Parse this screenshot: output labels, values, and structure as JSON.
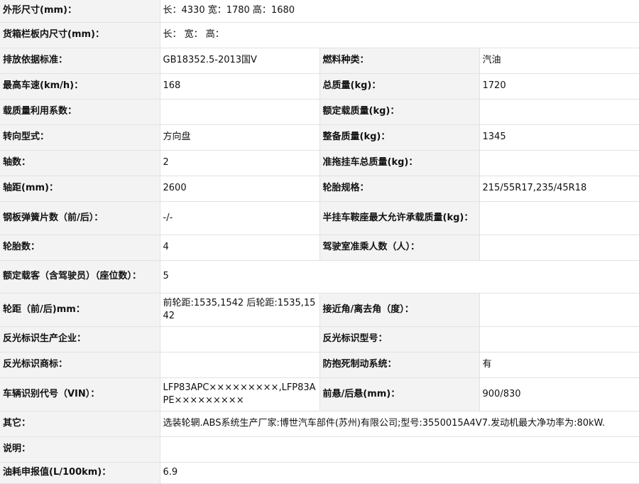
{
  "rows": [
    [
      {
        "t": "l",
        "text": "外形尺寸(mm)："
      },
      {
        "t": "v",
        "text": "长：4330 宽：1780 高：1680",
        "span": 3
      }
    ],
    [
      {
        "t": "l",
        "text": "货箱栏板内尺寸(mm)："
      },
      {
        "t": "v",
        "text": "长： 宽： 高：",
        "span": 3
      }
    ],
    [
      {
        "t": "l",
        "text": "排放依据标准："
      },
      {
        "t": "v",
        "text": "GB18352.5-2013国Ⅴ"
      },
      {
        "t": "l",
        "text": "燃料种类："
      },
      {
        "t": "v",
        "text": "汽油"
      }
    ],
    [
      {
        "t": "l",
        "text": "最高车速(km/h)："
      },
      {
        "t": "v",
        "text": "168"
      },
      {
        "t": "l",
        "text": "总质量(kg)："
      },
      {
        "t": "v",
        "text": "1720"
      }
    ],
    [
      {
        "t": "l",
        "text": "载质量利用系数："
      },
      {
        "t": "v",
        "text": ""
      },
      {
        "t": "l",
        "text": "额定载质量(kg)："
      },
      {
        "t": "v",
        "text": ""
      }
    ],
    [
      {
        "t": "l",
        "text": "转向型式："
      },
      {
        "t": "v",
        "text": "方向盘"
      },
      {
        "t": "l",
        "text": "整备质量(kg)："
      },
      {
        "t": "v",
        "text": "1345"
      }
    ],
    [
      {
        "t": "l",
        "text": "轴数："
      },
      {
        "t": "v",
        "text": "2"
      },
      {
        "t": "l",
        "text": "准拖挂车总质量(kg)："
      },
      {
        "t": "v",
        "text": ""
      }
    ],
    [
      {
        "t": "l",
        "text": "轴距(mm)："
      },
      {
        "t": "v",
        "text": "2600"
      },
      {
        "t": "l",
        "text": "轮胎规格："
      },
      {
        "t": "v",
        "text": "215/55R17,235/45R18"
      }
    ],
    [
      {
        "t": "l",
        "text": "钢板弹簧片数（前/后）："
      },
      {
        "t": "v",
        "text": "-/-"
      },
      {
        "t": "l",
        "text": "半挂车鞍座最大允许承载质量(kg)："
      },
      {
        "t": "v",
        "text": ""
      }
    ],
    [
      {
        "t": "l",
        "text": "轮胎数："
      },
      {
        "t": "v",
        "text": "4"
      },
      {
        "t": "l",
        "text": "驾驶室准乘人数（人）："
      },
      {
        "t": "v",
        "text": ""
      }
    ],
    [
      {
        "t": "l",
        "text": "额定载客（含驾驶员）（座位数）："
      },
      {
        "t": "v",
        "text": "5",
        "span": 3
      }
    ],
    [
      {
        "t": "l",
        "text": "轮距（前/后)mm："
      },
      {
        "t": "v",
        "text": "前轮距:1535,1542 后轮距:1535,1542"
      },
      {
        "t": "l",
        "text": "接近角/离去角（度）："
      },
      {
        "t": "v",
        "text": ""
      }
    ],
    [
      {
        "t": "l",
        "text": "反光标识生产企业："
      },
      {
        "t": "v",
        "text": ""
      },
      {
        "t": "l",
        "text": "反光标识型号："
      },
      {
        "t": "v",
        "text": ""
      }
    ],
    [
      {
        "t": "l",
        "text": "反光标识商标："
      },
      {
        "t": "v",
        "text": ""
      },
      {
        "t": "l",
        "text": "防抱死制动系统："
      },
      {
        "t": "v",
        "text": "有"
      }
    ],
    [
      {
        "t": "l",
        "text": "车辆识别代号（VIN）："
      },
      {
        "t": "v",
        "text": "LFP83APC×××××××××,LFP83APE×××××××××"
      },
      {
        "t": "l",
        "text": "前悬/后悬(mm)："
      },
      {
        "t": "v",
        "text": "900/830"
      }
    ],
    [
      {
        "t": "l",
        "text": "其它："
      },
      {
        "t": "v",
        "text": "选装轮辋.ABS系统生产厂家:博世汽车部件(苏州)有限公司;型号:3550015A4V7.发动机最大净功率为:80kW.",
        "span": 3
      }
    ],
    [
      {
        "t": "l",
        "text": "说明："
      },
      {
        "t": "v",
        "text": "",
        "span": 3
      }
    ],
    [
      {
        "t": "l",
        "text": "油耗申报值(L/100km)："
      },
      {
        "t": "v",
        "text": "6.9",
        "span": 3
      }
    ]
  ]
}
